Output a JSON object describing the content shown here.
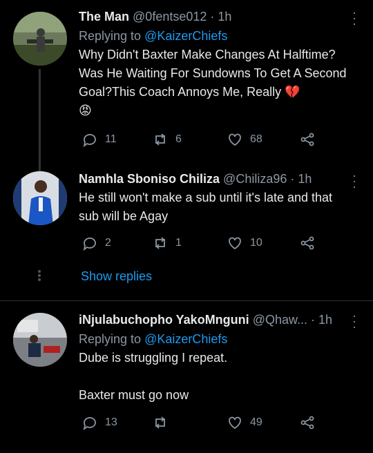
{
  "tweets": [
    {
      "name": "The Man",
      "handle": "@0fentse012",
      "time": "· 1h",
      "replying_prefix": "Replying to",
      "replying_to": "@KaizerChiefs",
      "text": "Why Didn't Baxter Make Changes At Halftime? Was He Waiting For Sundowns To Get A Second Goal?This Coach Annoys Me, Really 💔",
      "emoji_line": "😡",
      "replies": "11",
      "retweets": "6",
      "likes": "68"
    },
    {
      "name": "Namhla Sboniso Chiliza",
      "handle": "@Chiliza96",
      "time": "· 1h",
      "text": "He still won't make a sub until it's late and that sub will be Agay",
      "replies": "2",
      "retweets": "1",
      "likes": "10"
    },
    {
      "name": "iNjulabuchopho YakoMnguni",
      "handle": "@Qhaw...",
      "time": "· 1h",
      "replying_prefix": "Replying to",
      "replying_to": "@KaizerChiefs",
      "text_line1": "Dube is struggling I repeat.",
      "text_line2": "Baxter must go now",
      "replies": "13",
      "retweets": "",
      "likes": "49"
    }
  ],
  "show_replies": "Show replies",
  "colors": {
    "link": "#1d9bf0",
    "muted": "#8b98a5",
    "background": "#000000"
  }
}
